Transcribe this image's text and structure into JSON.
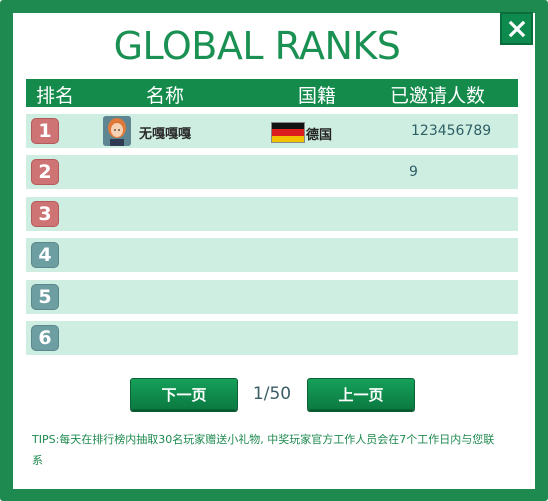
{
  "title": "GLOBAL RANKS",
  "close_icon": "close-x-icon",
  "header": {
    "rank": "排名",
    "name": "名称",
    "country": "国籍",
    "invites": "已邀请人数"
  },
  "rows": [
    {
      "rank": "1",
      "name": "无嘎嘎嘎",
      "country": "德国",
      "invites": "123456789",
      "avatar": "player-avatar-icon",
      "flag": "germany-flag-icon"
    },
    {
      "rank": "2",
      "name": "",
      "country": "",
      "invites": "9"
    },
    {
      "rank": "3",
      "name": "",
      "country": "",
      "invites": ""
    },
    {
      "rank": "4",
      "name": "",
      "country": "",
      "invites": ""
    },
    {
      "rank": "5",
      "name": "",
      "country": "",
      "invites": ""
    },
    {
      "rank": "6",
      "name": "",
      "country": "",
      "invites": ""
    }
  ],
  "pagination": {
    "next_label": "下一页",
    "prev_label": "上一页",
    "page": "1/50"
  },
  "tips": "TIPS:每天在排行榜内抽取30名玩家赠送小礼物, 中奖玩家官方工作人员会在7个工作日内与您联系",
  "colors": {
    "frame": "#1e8a4f",
    "header": "#148a4b",
    "row_bg": "#cdeee0",
    "rank_top": "#cf7474",
    "rank_low": "#6d9ea2",
    "title": "#1a9152"
  }
}
